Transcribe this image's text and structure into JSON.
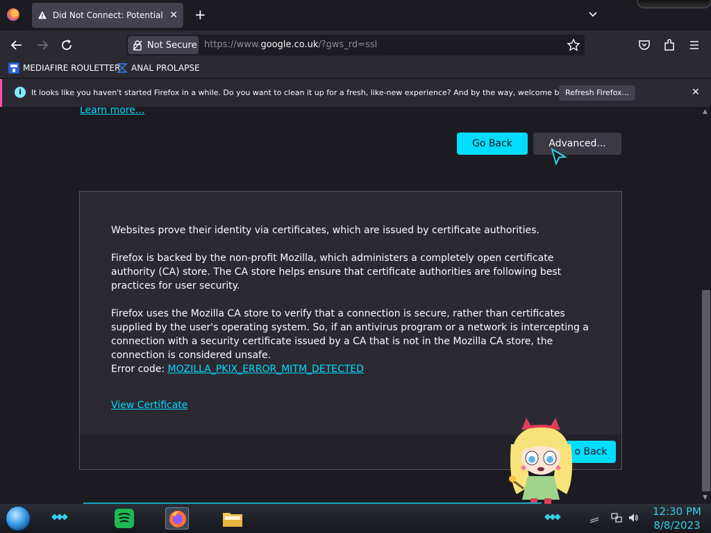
{
  "tab": {
    "title": "Did Not Connect: Potential Sec",
    "close_label": "✕"
  },
  "toolbar": {
    "new_tab_label": "+",
    "security_label": "Not Secure",
    "url_prefix": "https://www.",
    "url_host": "google.co.uk",
    "url_suffix": "/?gws_rd=ssl"
  },
  "bookmarks": [
    {
      "label": "MEDIAFIRE ROULETTER",
      "icon": "mediafire-icon"
    },
    {
      "label": "ANAL PROLAPSE",
      "icon": "bookmark-folder-icon"
    }
  ],
  "notification": {
    "message": "It looks like you haven't started Firefox in a while. Do you want to clean it up for a fresh, like-new experience? And by the way, welcome back!",
    "button_label": "Refresh Firefox...",
    "close_label": "✕"
  },
  "page": {
    "learn_more": "Learn more...",
    "go_back_label": "Go Back",
    "advanced_label": "Advanced...",
    "advanced_panel": {
      "para1": "Websites prove their identity via certificates, which are issued by certificate authorities.",
      "para2": "Firefox is backed by the non-profit Mozilla, which administers a completely open certificate authority (CA) store. The CA store helps ensure that certificate authorities are following best practices for user security.",
      "para3": "Firefox uses the Mozilla CA store to verify that a connection is secure, rather than certificates supplied by the user's operating system. So, if an antivirus program or a network is intercepting a connection with a security certificate issued by a CA that is not in the Mozilla CA store, the connection is considered unsafe.",
      "error_code_label": "Error code: ",
      "error_code": "MOZILLA_PKIX_ERROR_MITM_DETECTED",
      "view_certificate": "View Certificate",
      "go_back_label": "o Back"
    }
  },
  "taskbar": {
    "time": "12:30 PM",
    "date": "8/8/2023",
    "apps": [
      "spotify-icon",
      "firefox-icon",
      "file-explorer-icon"
    ]
  },
  "colors": {
    "accent": "#00ddff",
    "page_bg": "#1c1b22",
    "toolbar_bg": "#2b2a33",
    "notification_stripe": "#ff4fa8",
    "clock": "#35d0e8"
  }
}
